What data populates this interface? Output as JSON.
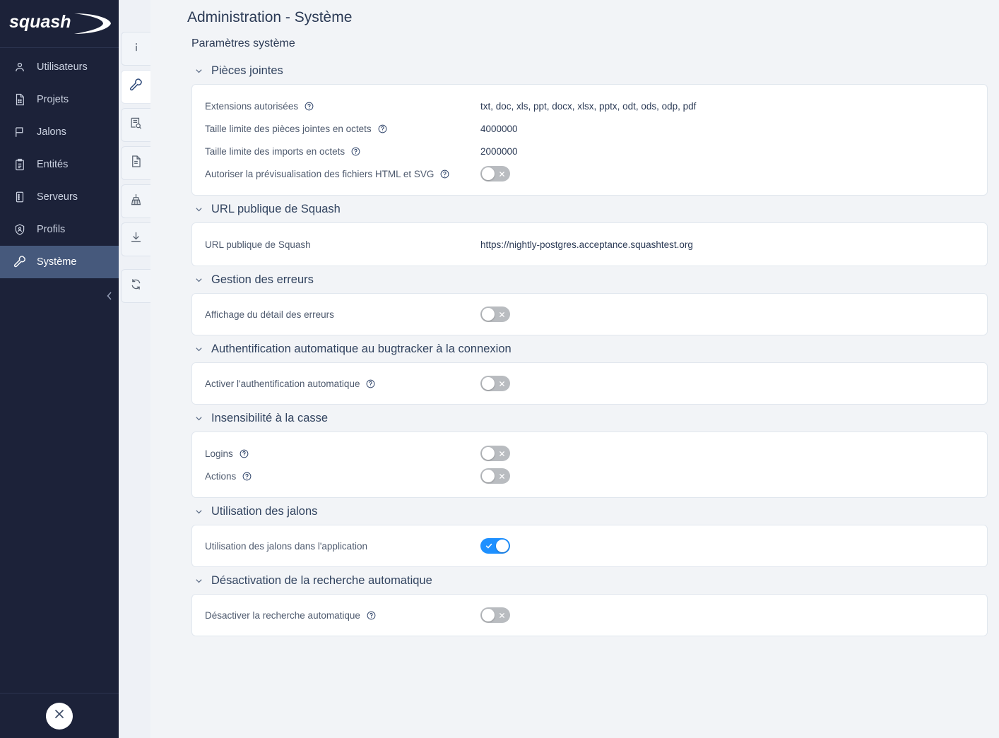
{
  "brand": {
    "name": "squash"
  },
  "sidebar": {
    "items": [
      {
        "label": "Utilisateurs",
        "icon": "user-icon",
        "active": false
      },
      {
        "label": "Projets",
        "icon": "projects-icon",
        "active": false
      },
      {
        "label": "Jalons",
        "icon": "flag-icon",
        "active": false
      },
      {
        "label": "Entités",
        "icon": "clipboard-icon",
        "active": false
      },
      {
        "label": "Serveurs",
        "icon": "server-icon",
        "active": false
      },
      {
        "label": "Profils",
        "icon": "shield-user-icon",
        "active": false
      },
      {
        "label": "Système",
        "icon": "wrench-icon",
        "active": true
      }
    ],
    "collapse_icon": "chevron-left-icon",
    "close_icon": "close-icon"
  },
  "rail": {
    "tabs": [
      {
        "icon": "info-icon",
        "active": false
      },
      {
        "icon": "wrench-icon",
        "active": true
      },
      {
        "icon": "log-search-icon",
        "active": false
      },
      {
        "icon": "document-icon",
        "active": false
      },
      {
        "icon": "broom-icon",
        "active": false
      },
      {
        "icon": "download-icon",
        "active": false
      },
      {
        "icon": "refresh-icon",
        "active": false
      }
    ]
  },
  "header": {
    "title": "Administration - Système",
    "subtitle": "Paramètres système"
  },
  "sections": [
    {
      "title": "Pièces jointes",
      "collapse_icon": "chevron-down-icon",
      "rows": [
        {
          "label": "Extensions autorisées",
          "help": true,
          "type": "text",
          "value": "txt, doc, xls, ppt, docx, xlsx, pptx, odt, ods, odp, pdf"
        },
        {
          "label": "Taille limite des pièces jointes en octets",
          "help": true,
          "type": "text",
          "value": "4000000"
        },
        {
          "label": "Taille limite des imports en octets",
          "help": true,
          "type": "text",
          "value": "2000000"
        },
        {
          "label": "Autoriser la prévisualisation des fichiers HTML et SVG",
          "help": true,
          "type": "toggle",
          "value": false
        }
      ]
    },
    {
      "title": "URL publique de Squash",
      "collapse_icon": "chevron-down-icon",
      "rows": [
        {
          "label": "URL publique de Squash",
          "help": false,
          "type": "text",
          "value": "https://nightly-postgres.acceptance.squashtest.org"
        }
      ]
    },
    {
      "title": "Gestion des erreurs",
      "collapse_icon": "chevron-down-icon",
      "rows": [
        {
          "label": "Affichage du détail des erreurs",
          "help": false,
          "type": "toggle",
          "value": false
        }
      ]
    },
    {
      "title": "Authentification automatique au bugtracker à la connexion",
      "collapse_icon": "chevron-down-icon",
      "rows": [
        {
          "label": "Activer l'authentification automatique",
          "help": true,
          "type": "toggle",
          "value": false
        }
      ]
    },
    {
      "title": "Insensibilité à la casse",
      "collapse_icon": "chevron-down-icon",
      "rows": [
        {
          "label": "Logins",
          "help": true,
          "type": "toggle",
          "value": false
        },
        {
          "label": "Actions",
          "help": true,
          "type": "toggle",
          "value": false
        }
      ]
    },
    {
      "title": "Utilisation des jalons",
      "collapse_icon": "chevron-down-icon",
      "rows": [
        {
          "label": "Utilisation des jalons dans l'application",
          "help": false,
          "type": "toggle",
          "value": true
        }
      ]
    },
    {
      "title": "Désactivation de la recherche automatique",
      "collapse_icon": "chevron-down-icon",
      "rows": [
        {
          "label": "Désactiver la recherche automatique",
          "help": true,
          "type": "toggle",
          "value": false
        }
      ]
    }
  ],
  "colors": {
    "sidebar_bg": "#1c2239",
    "sidebar_active": "#46597c",
    "accent_blue": "#1e90ff",
    "page_bg": "#f2f4f7",
    "title_text": "#2b3a55",
    "toggle_off": "#b9bcc0"
  }
}
